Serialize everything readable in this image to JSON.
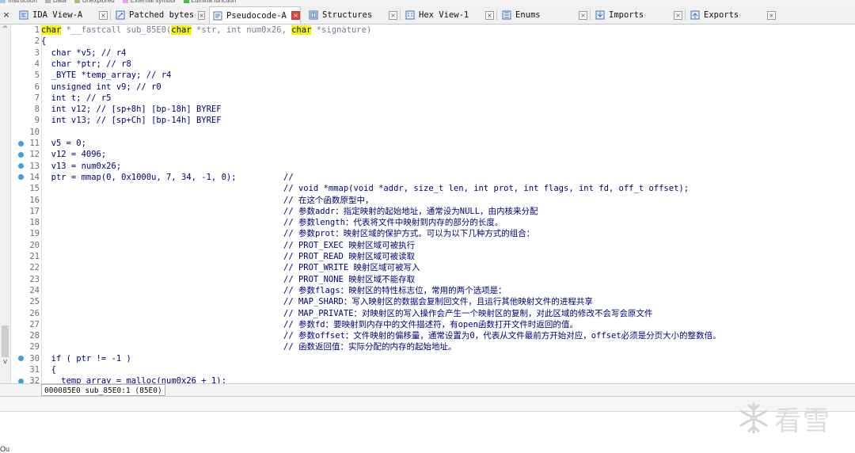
{
  "legend": [
    {
      "label": "Instruction",
      "color": "#a0c8f0"
    },
    {
      "label": "Data",
      "color": "#b0b0b0"
    },
    {
      "label": "Unexplored",
      "color": "#b8b86c"
    },
    {
      "label": "External symbol",
      "color": "#f0a0f0"
    },
    {
      "label": "Lumina function",
      "color": "#40c040"
    }
  ],
  "tabs": [
    {
      "label": "IDA View-A",
      "icon": "ida-view-icon",
      "active": false
    },
    {
      "label": "Patched bytes",
      "icon": "patched-bytes-icon",
      "active": false
    },
    {
      "label": "Pseudocode-A",
      "icon": "pseudocode-icon",
      "active": true
    },
    {
      "label": "Structures",
      "icon": "structures-icon",
      "active": false
    },
    {
      "label": "Hex View-1",
      "icon": "hex-view-icon",
      "active": false
    },
    {
      "label": "Enums",
      "icon": "enums-icon",
      "active": false
    },
    {
      "label": "Imports",
      "icon": "imports-icon",
      "active": false
    },
    {
      "label": "Exports",
      "icon": "exports-icon",
      "active": false
    }
  ],
  "tab_close_glyph": "×",
  "code_lines": [
    {
      "n": "1",
      "bp": false,
      "code": "char *__fastcall sub_85E0(char *str, int num0x26, char *signature)",
      "comment": ""
    },
    {
      "n": "2",
      "bp": false,
      "code": "{",
      "comment": ""
    },
    {
      "n": "3",
      "bp": false,
      "code": "  char *v5; // r4",
      "comment": ""
    },
    {
      "n": "4",
      "bp": false,
      "code": "  char *ptr; // r8",
      "comment": ""
    },
    {
      "n": "5",
      "bp": false,
      "code": "  _BYTE *temp_array; // r4",
      "comment": ""
    },
    {
      "n": "6",
      "bp": false,
      "code": "  unsigned int v9; // r0",
      "comment": ""
    },
    {
      "n": "7",
      "bp": false,
      "code": "  int t; // r5",
      "comment": ""
    },
    {
      "n": "8",
      "bp": false,
      "code": "  int v12; // [sp+8h] [bp-18h] BYREF",
      "comment": ""
    },
    {
      "n": "9",
      "bp": false,
      "code": "  int v13; // [sp+Ch] [bp-14h] BYREF",
      "comment": ""
    },
    {
      "n": "10",
      "bp": false,
      "code": "",
      "comment": ""
    },
    {
      "n": "11",
      "bp": true,
      "code": "  v5 = 0;",
      "comment": ""
    },
    {
      "n": "12",
      "bp": true,
      "code": "  v12 = 4096;",
      "comment": ""
    },
    {
      "n": "13",
      "bp": true,
      "code": "  v13 = num0x26;",
      "comment": ""
    },
    {
      "n": "14",
      "bp": true,
      "code": "  ptr = mmap(0, 0x1000u, 7, 34, -1, 0);",
      "comment": "//"
    },
    {
      "n": "15",
      "bp": false,
      "code": "",
      "comment": "// void *mmap(void *addr, size_t len, int prot, int flags, int fd, off_t offset);"
    },
    {
      "n": "16",
      "bp": false,
      "code": "",
      "comment": "// 在这个函数原型中，"
    },
    {
      "n": "17",
      "bp": false,
      "code": "",
      "comment": "// 参数addr：指定映射的起始地址，通常设为NULL，由内核来分配"
    },
    {
      "n": "18",
      "bp": false,
      "code": "",
      "comment": "// 参数length：代表将文件中映射到内存的部分的长度。"
    },
    {
      "n": "19",
      "bp": false,
      "code": "",
      "comment": "// 参数prot：映射区域的保护方式。可以为以下几种方式的组合："
    },
    {
      "n": "20",
      "bp": false,
      "code": "",
      "comment": "// PROT_EXEC 映射区域可被执行"
    },
    {
      "n": "21",
      "bp": false,
      "code": "",
      "comment": "// PROT_READ 映射区域可被读取"
    },
    {
      "n": "22",
      "bp": false,
      "code": "",
      "comment": "// PROT_WRITE 映射区域可被写入"
    },
    {
      "n": "23",
      "bp": false,
      "code": "",
      "comment": "// PROT_NONE 映射区域不能存取"
    },
    {
      "n": "24",
      "bp": false,
      "code": "",
      "comment": "// 参数flags：映射区的特性标志位，常用的两个选项是："
    },
    {
      "n": "25",
      "bp": false,
      "code": "",
      "comment": "// MAP_SHARD：写入映射区的数据会复制回文件，且运行其他映射文件的进程共享"
    },
    {
      "n": "26",
      "bp": false,
      "code": "",
      "comment": "// MAP_PRIVATE：对映射区的写入操作会产生一个映射区的复制，对此区域的修改不会写会原文件"
    },
    {
      "n": "27",
      "bp": false,
      "code": "",
      "comment": "// 参数fd：要映射到内存中的文件描述符，有open函数打开文件时返回的值。"
    },
    {
      "n": "28",
      "bp": false,
      "code": "",
      "comment": "// 参数offset：文件映射的偏移量，通常设置为0，代表从文件最前方开始对应，offset必须是分页大小的整数倍。"
    },
    {
      "n": "29",
      "bp": false,
      "code": "",
      "comment": "// 函数返回值：实际分配的内存的起始地址。"
    },
    {
      "n": "30",
      "bp": true,
      "code": "  if ( ptr != -1 )",
      "comment": ""
    },
    {
      "n": "31",
      "bp": false,
      "code": "  {",
      "comment": ""
    },
    {
      "n": "32",
      "bp": true,
      "code": "    temp_array = malloc(num0x26 + 1);",
      "comment": ""
    }
  ],
  "status": {
    "location": "000085E0 sub_85E0:1 (85E0)"
  },
  "bottom_label": "Ou",
  "watermark": {
    "text": "看雪"
  }
}
